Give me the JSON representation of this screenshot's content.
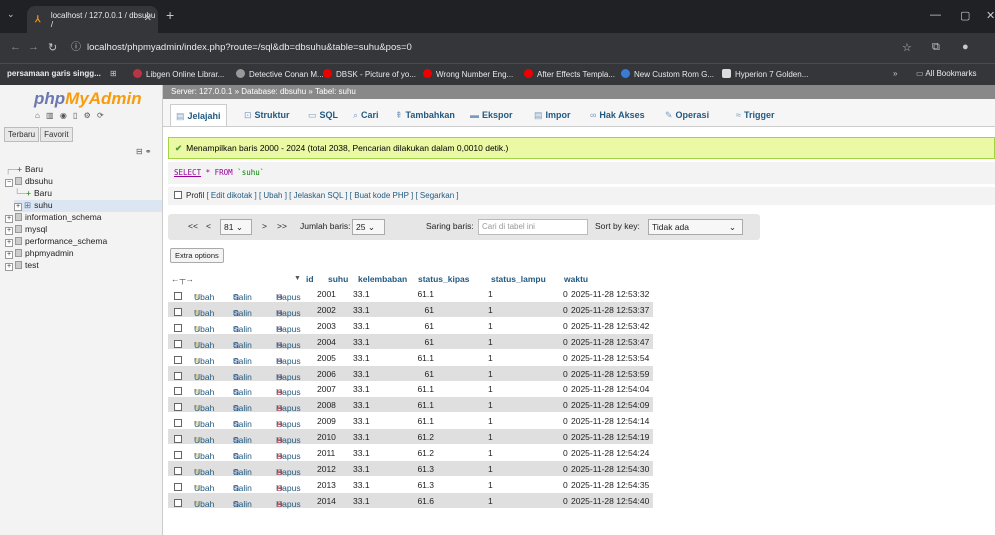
{
  "browser": {
    "tab_title": "localhost / 127.0.0.1 / dbsuhu /",
    "url": "localhost/phpmyadmin/index.php?route=/sql&db=dbsuhu&table=suhu&pos=0",
    "bookmarks": [
      "persamaan garis singg...",
      "Libgen Online Librar...",
      "Detective Conan M...",
      "DBSK - Picture of yo...",
      "Wrong Number Eng...",
      "After Effects Templa...",
      "New Custom Rom G...",
      "Hyperion 7 Golden...",
      "All Bookmarks"
    ]
  },
  "sidebar": {
    "logo_php": "php",
    "logo_my": "MyAdmin",
    "tabs": [
      "Terbaru",
      "Favorit"
    ],
    "tree": [
      {
        "label": "Baru",
        "kind": "new"
      },
      {
        "label": "dbsuhu",
        "kind": "db"
      },
      {
        "label": "Baru",
        "kind": "new"
      },
      {
        "label": "suhu",
        "kind": "table"
      },
      {
        "label": "information_schema",
        "kind": "db"
      },
      {
        "label": "mysql",
        "kind": "db"
      },
      {
        "label": "performance_schema",
        "kind": "db"
      },
      {
        "label": "phpmyadmin",
        "kind": "db"
      },
      {
        "label": "test",
        "kind": "db"
      }
    ]
  },
  "breadcrumb": "Server: 127.0.0.1 » Database: dbsuhu » Tabel: suhu",
  "tabs": [
    "Jelajahi",
    "Struktur",
    "SQL",
    "Cari",
    "Tambahkan",
    "Ekspor",
    "Impor",
    "Hak Akses",
    "Operasi",
    "Trigger"
  ],
  "message": "Menampilkan baris 2000 - 2024 (total 2038, Pencarian dilakukan dalam 0,0010 detik.)",
  "sql": {
    "keyword": "SELECT",
    "rest": " * FROM ",
    "table": "`suhu`"
  },
  "profile": {
    "label": "Profil",
    "links": "[ Edit dikotak ] [ Ubah ] [ Jelaskan SQL ] [ Buat kode PHP ] [ Segarkan ]"
  },
  "pager": {
    "prev_first": "<<",
    "prev": "<",
    "page": "81",
    "next": ">",
    "next_last": ">>",
    "rows_label": "Jumlah baris:",
    "rows_value": "25",
    "filter_label": "Saring baris:",
    "filter_placeholder": "Cari di tabel ini",
    "sort_label": "Sort by key:",
    "sort_value": "Tidak ada"
  },
  "extra_options": "Extra options",
  "table": {
    "headers": [
      "id",
      "suhu",
      "kelembaban",
      "status_kipas",
      "status_lampu",
      "waktu"
    ],
    "action_labels": {
      "edit": "Ubah",
      "copy": "Salin",
      "delete": "Hapus"
    },
    "rows": [
      [
        "2001",
        "33.1",
        "61.1",
        "1",
        "0",
        "2025-11-28 12:53:32"
      ],
      [
        "2002",
        "33.1",
        "61",
        "1",
        "0",
        "2025-11-28 12:53:37"
      ],
      [
        "2003",
        "33.1",
        "61",
        "1",
        "0",
        "2025-11-28 12:53:42"
      ],
      [
        "2004",
        "33.1",
        "61",
        "1",
        "0",
        "2025-11-28 12:53:47"
      ],
      [
        "2005",
        "33.1",
        "61.1",
        "1",
        "0",
        "2025-11-28 12:53:54"
      ],
      [
        "2006",
        "33.1",
        "61",
        "1",
        "0",
        "2025-11-28 12:53:59"
      ],
      [
        "2007",
        "33.1",
        "61.1",
        "1",
        "0",
        "2025-11-28 12:54:04"
      ],
      [
        "2008",
        "33.1",
        "61.1",
        "1",
        "0",
        "2025-11-28 12:54:09"
      ],
      [
        "2009",
        "33.1",
        "61.1",
        "1",
        "0",
        "2025-11-28 12:54:14"
      ],
      [
        "2010",
        "33.1",
        "61.2",
        "1",
        "0",
        "2025-11-28 12:54:19"
      ],
      [
        "2011",
        "33.1",
        "61.2",
        "1",
        "0",
        "2025-11-28 12:54:24"
      ],
      [
        "2012",
        "33.1",
        "61.3",
        "1",
        "0",
        "2025-11-28 12:54:30"
      ],
      [
        "2013",
        "33.1",
        "61.3",
        "1",
        "0",
        "2025-11-28 12:54:35"
      ],
      [
        "2014",
        "33.1",
        "61.6",
        "1",
        "0",
        "2025-11-28 12:54:40"
      ]
    ]
  }
}
